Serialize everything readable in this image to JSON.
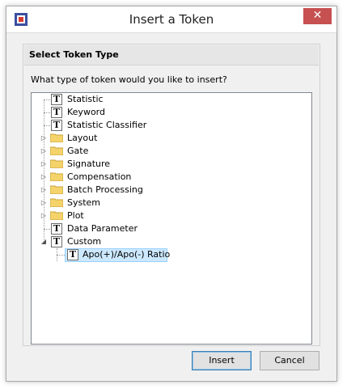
{
  "window": {
    "title": "Insert a Token",
    "close_label": "✕"
  },
  "group": {
    "header": "Select Token Type",
    "question": "What type of token would you like to insert?"
  },
  "tree": {
    "items": [
      {
        "label": "Statistic",
        "icon": "token-t-icon"
      },
      {
        "label": "Keyword",
        "icon": "token-t-icon"
      },
      {
        "label": "Statistic Classifier",
        "icon": "token-t-icon"
      },
      {
        "label": "Layout",
        "icon": "folder-icon"
      },
      {
        "label": "Gate",
        "icon": "folder-icon"
      },
      {
        "label": "Signature",
        "icon": "folder-icon"
      },
      {
        "label": "Compensation",
        "icon": "folder-icon"
      },
      {
        "label": "Batch Processing",
        "icon": "folder-icon"
      },
      {
        "label": "System",
        "icon": "folder-icon"
      },
      {
        "label": "Plot",
        "icon": "folder-icon"
      },
      {
        "label": "Data Parameter",
        "icon": "token-t-icon"
      },
      {
        "label": "Custom",
        "icon": "token-t-icon"
      }
    ],
    "child": {
      "label": "Apo(+)/Apo(-) Ratio",
      "icon": "token-t-icon"
    }
  },
  "buttons": {
    "insert": "Insert",
    "cancel": "Cancel"
  },
  "colors": {
    "selection": "#cce8ff",
    "close": "#c75050",
    "folder": "#f5d36b"
  }
}
